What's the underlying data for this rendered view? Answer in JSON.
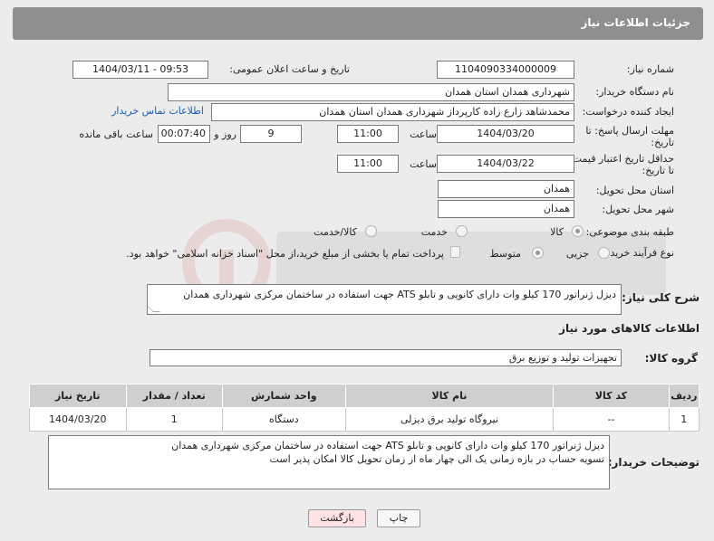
{
  "header": {
    "title": "جزئیات اطلاعات نیاز"
  },
  "fields": {
    "need_number_label": "شماره نیاز:",
    "need_number": "1104090334000009",
    "announce_label": "تاریخ و ساعت اعلان عمومی:",
    "announce_value": "1404/03/11 - 09:53",
    "buyer_org_label": "نام دستگاه خریدار:",
    "buyer_org": "شهرداری همدان استان همدان",
    "creator_label": "ایجاد کننده درخواست:",
    "creator": "محمدشاهد زارع زاده کارپرداز شهرداری همدان استان همدان",
    "contact_link": "اطلاعات تماس خریدار",
    "deadline_label_1": "مهلت ارسال پاسخ: تا",
    "deadline_label_2": "تاریخ:",
    "deadline_date": "1404/03/20",
    "time_label": "ساعت",
    "deadline_time": "11:00",
    "days_value": "9",
    "days_label": "روز و",
    "remaining_value": "00:07:40",
    "remaining_label": "ساعت باقی مانده",
    "validity_label_1": "حداقل تاریخ اعتبار قیمت:",
    "validity_label_2": "تا تاریخ:",
    "validity_date": "1404/03/22",
    "validity_time": "11:00",
    "province_label": "استان محل تحویل:",
    "province": "همدان",
    "city_label": "شهر محل تحویل:",
    "city": "همدان",
    "category_label": "طبقه بندی موضوعی:",
    "category_options": [
      "کالا",
      "خدمت",
      "کالا/خدمت"
    ],
    "process_label": "نوع فرآیند خرید :",
    "process_options": [
      "جزیی",
      "متوسط"
    ],
    "payment_note": "پرداخت تمام یا بخشی از مبلغ خرید،از محل \"اسناد خزانه اسلامی\" خواهد بود."
  },
  "description": {
    "label": "شرح کلی نیاز:",
    "text": "دیزل ژنراتور 170 کیلو وات دارای کانوپی و تابلو ATS جهت استفاده در ساختمان مرکزی شهرداری همدان"
  },
  "goods": {
    "section_title": "اطلاعات کالاهای مورد نیاز",
    "group_label": "گروه کالا:",
    "group_value": "تجهیزات تولید و توزیع برق",
    "columns": [
      "ردیف",
      "کد کالا",
      "نام کالا",
      "واحد شمارش",
      "تعداد / مقدار",
      "تاریخ نیاز"
    ],
    "rows": [
      [
        "1",
        "--",
        "نیروگاه تولید برق دیزلی",
        "دستگاه",
        "1",
        "1404/03/20"
      ]
    ]
  },
  "buyer_notes": {
    "label": "توضیحات خریدار:",
    "line1": "دیزل ژنراتور 170 کیلو وات دارای کانوپی و تابلو ATS جهت استفاده در ساختمان مرکزی شهرداری همدان",
    "line2": "تسویه حساب در بازه زمانی یک الی چهار ماه از زمان تحویل کالا امکان پذیر است"
  },
  "buttons": {
    "print": "چاپ",
    "back": "بازگشت"
  },
  "colors": {
    "header_bg": "#8f8f8f",
    "link": "#1a5fb4",
    "back_button_bg": "#fde3e3"
  }
}
